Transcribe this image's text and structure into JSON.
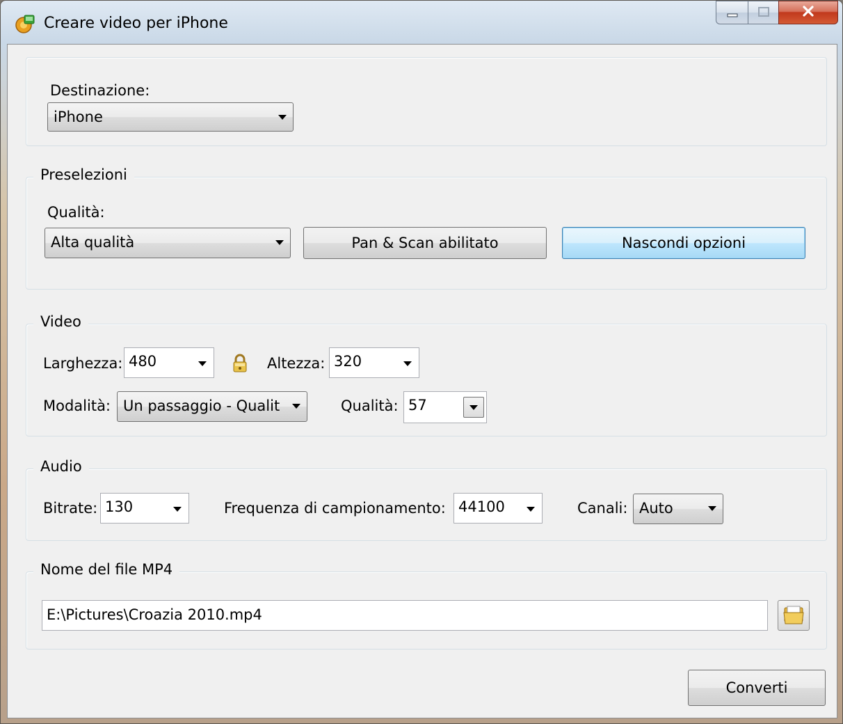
{
  "window": {
    "title": "Creare video per iPhone"
  },
  "destination": {
    "label": "Destinazione:",
    "value": "iPhone"
  },
  "presets": {
    "title": "Preselezioni",
    "quality_label": "Qualità:",
    "quality_value": "Alta qualità",
    "pan_scan_button": "Pan & Scan abilitato",
    "options_button": "Nascondi opzioni"
  },
  "video": {
    "title": "Video",
    "width_label": "Larghezza:",
    "width_value": "480",
    "height_label": "Altezza:",
    "height_value": "320",
    "mode_label": "Modalità:",
    "mode_value": "Un passaggio - Qualit",
    "quality_label": "Qualità:",
    "quality_value": "57"
  },
  "audio": {
    "title": "Audio",
    "bitrate_label": "Bitrate:",
    "bitrate_value": "130",
    "samplerate_label": "Frequenza di campionamento:",
    "samplerate_value": "44100",
    "channels_label": "Canali:",
    "channels_value": "Auto"
  },
  "file": {
    "title": "Nome del file MP4",
    "path": "E:\\Pictures\\Croazia 2010.mp4"
  },
  "convert_button": "Converti",
  "icons": {
    "app": "app-icon",
    "lock": "lock-icon",
    "browse": "folder-browse-icon",
    "minimize": "minimize-icon",
    "maximize": "maximize-icon",
    "close": "close-icon"
  }
}
